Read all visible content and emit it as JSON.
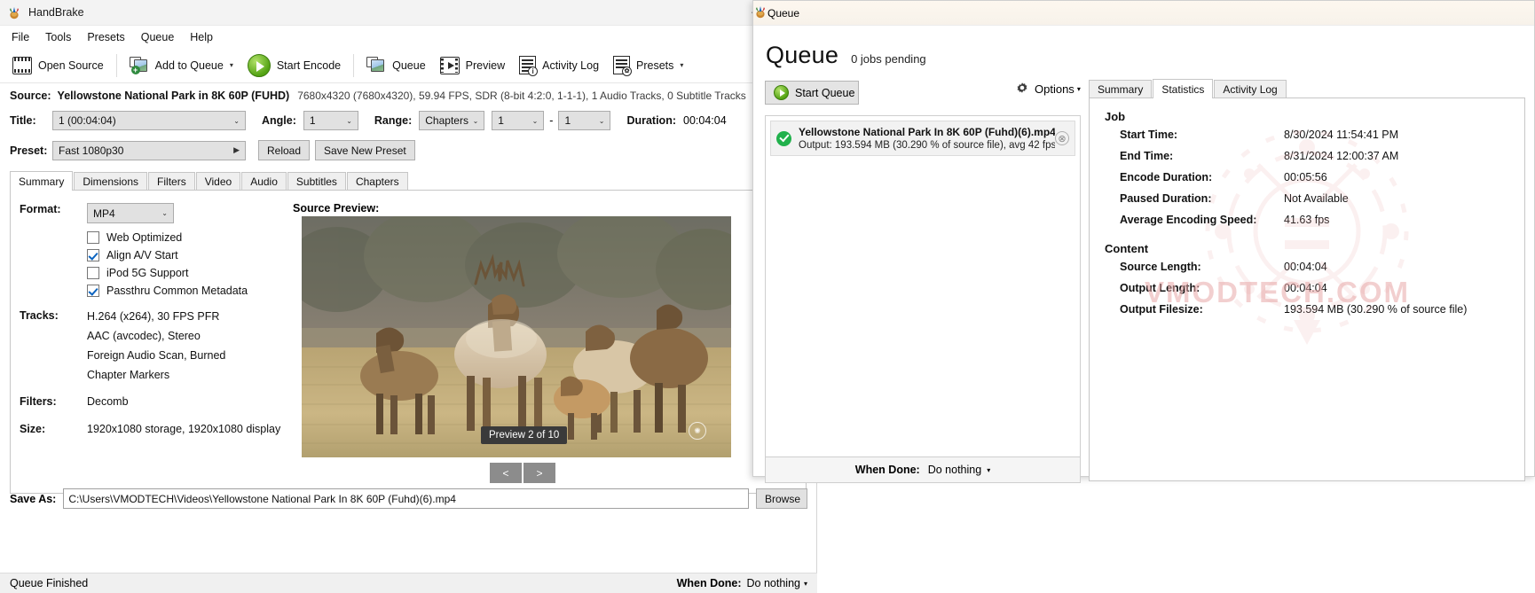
{
  "main_window": {
    "title": "HandBrake",
    "window_controls": {
      "minimize": "—",
      "maximize": "❐"
    },
    "menu": [
      "File",
      "Tools",
      "Presets",
      "Queue",
      "Help"
    ],
    "toolbar": [
      {
        "label": "Open Source",
        "icon": "film-icon"
      },
      {
        "label": "Add to Queue",
        "icon": "add-to-queue-icon",
        "caret": "▾"
      },
      {
        "label": "Start Encode",
        "icon": "play-icon"
      },
      {
        "label": "Queue",
        "icon": "queue-icon"
      },
      {
        "label": "Preview",
        "icon": "preview-icon"
      },
      {
        "label": "Activity Log",
        "icon": "activity-log-icon"
      },
      {
        "label": "Presets",
        "icon": "presets-icon",
        "caret": "▾"
      }
    ],
    "source": {
      "label": "Source:",
      "name": "Yellowstone National Park in 8K 60P (FUHD)",
      "meta": "7680x4320 (7680x4320), 59.94 FPS, SDR (8-bit 4:2:0, 1-1-1), 1 Audio Tracks, 0 Subtitle Tracks"
    },
    "title_row": {
      "title_label": "Title:",
      "title_value": "1 (00:04:04)",
      "angle_label": "Angle:",
      "angle_value": "1",
      "range_label": "Range:",
      "range_value": "Chapters",
      "range_from": "1",
      "range_dash": "-",
      "range_to": "1",
      "duration_label": "Duration:",
      "duration_value": "00:04:04"
    },
    "preset_row": {
      "label": "Preset:",
      "value": "Fast 1080p30",
      "reload": "Reload",
      "save_new_preset": "Save New Preset"
    },
    "tabs": [
      "Summary",
      "Dimensions",
      "Filters",
      "Video",
      "Audio",
      "Subtitles",
      "Chapters"
    ],
    "active_tab": "Summary",
    "summary": {
      "format_label": "Format:",
      "format_value": "MP4",
      "checkboxes": [
        {
          "label": "Web Optimized",
          "checked": false
        },
        {
          "label": "Align A/V Start",
          "checked": true
        },
        {
          "label": "iPod 5G Support",
          "checked": false
        },
        {
          "label": "Passthru Common Metadata",
          "checked": true
        }
      ],
      "tracks_label": "Tracks:",
      "tracks": [
        "H.264 (x264), 30 FPS PFR",
        "AAC (avcodec), Stereo",
        "Foreign Audio Scan, Burned",
        "Chapter Markers"
      ],
      "filters_label": "Filters:",
      "filters_value": "Decomb",
      "size_label": "Size:",
      "size_value": "1920x1080 storage, 1920x1080 display"
    },
    "preview": {
      "title": "Source Preview:",
      "badge": "Preview 2 of 10",
      "prev_button": "<",
      "next_button": ">"
    },
    "save_as": {
      "label": "Save As:",
      "path": "C:\\Users\\VMODTECH\\Videos\\Yellowstone National Park In 8K 60P (Fuhd)(6).mp4",
      "browse": "Browse"
    },
    "status": {
      "text": "Queue Finished",
      "when_done_label": "When Done:",
      "when_done_value": "Do nothing",
      "when_done_caret": "▾"
    }
  },
  "queue_window": {
    "titlebar": "Queue",
    "heading": "Queue",
    "pending": "0 jobs pending",
    "start_queue": "Start Queue",
    "options": "Options",
    "options_caret": "▾",
    "jobs": [
      {
        "status": "complete",
        "name": "Yellowstone National Park In 8K 60P (Fuhd)(6).mp4",
        "detail": "Output: 193.594 MB (30.290 % of source file), avg 42 fps",
        "remove": "⊗"
      }
    ],
    "when_done_label": "When Done:",
    "when_done_value": "Do nothing",
    "when_done_caret": "▾",
    "tabs": [
      "Summary",
      "Statistics",
      "Activity Log"
    ],
    "active_tab": "Statistics",
    "statistics": {
      "job_heading": "Job",
      "job_rows": [
        {
          "key": "Start Time:",
          "value": "8/30/2024 11:54:41 PM"
        },
        {
          "key": "End Time:",
          "value": "8/31/2024 12:00:37 AM"
        },
        {
          "key": "Encode Duration:",
          "value": "00:05:56"
        },
        {
          "key": "Paused Duration:",
          "value": "Not Available"
        },
        {
          "key": "Average Encoding Speed:",
          "value": "41.63 fps"
        }
      ],
      "content_heading": "Content",
      "content_rows": [
        {
          "key": "Source Length:",
          "value": "00:04:04"
        },
        {
          "key": "Output Length:",
          "value": "00:04:04"
        },
        {
          "key": "Output Filesize:",
          "value": "193.594 MB (30.290 % of source file)"
        }
      ]
    },
    "watermark_text": "VMODTECH.COM"
  },
  "colors": {
    "accent_green": "#54a314",
    "ok_green": "#21b14c",
    "window_bg": "#ffffff",
    "control_bg": "#e1e1e1",
    "watermark": "#e8a9a9"
  }
}
